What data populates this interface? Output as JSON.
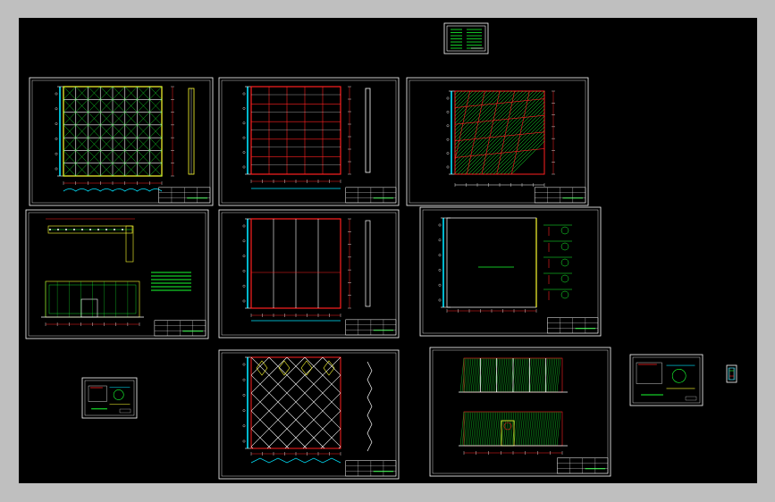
{
  "app": {
    "background_color": "#bfbfbf",
    "canvas_color": "#000000"
  },
  "colors": {
    "sheet_border": "#ffffff",
    "title_block": "#ffffff",
    "cad_cyan": "#00e5ff",
    "cad_green": "#18ff30",
    "cad_red": "#ff2020",
    "cad_yellow": "#ffff30",
    "cad_white": "#ffffff"
  },
  "sheets": [
    {
      "id": "cover",
      "kind": "cover"
    },
    {
      "id": "s1",
      "kind": "diamond-grid"
    },
    {
      "id": "s2",
      "kind": "rect-grid"
    },
    {
      "id": "s3",
      "kind": "hatch-grid"
    },
    {
      "id": "s4",
      "kind": "plan-elevation"
    },
    {
      "id": "s5",
      "kind": "plain-panel"
    },
    {
      "id": "s6",
      "kind": "section-detail"
    },
    {
      "id": "s7",
      "kind": "diamond-lattice"
    },
    {
      "id": "s8",
      "kind": "wall-elevations"
    },
    {
      "id": "d1",
      "kind": "small-detail"
    },
    {
      "id": "d2",
      "kind": "small-detail-wide"
    },
    {
      "id": "d3",
      "kind": "tiny-detail"
    }
  ]
}
